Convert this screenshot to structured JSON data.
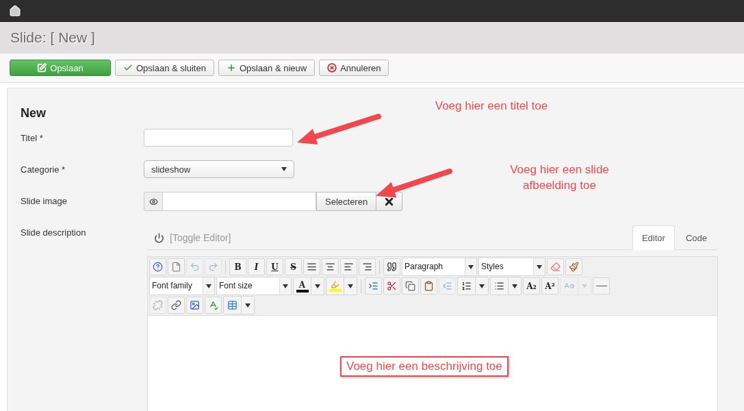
{
  "header": {
    "title": "Slide:",
    "subtitle": "[ New ]"
  },
  "toolbar": [
    {
      "kind": "save",
      "label": "Opslaan"
    },
    {
      "kind": "check",
      "label": "Opslaan & sluiten"
    },
    {
      "kind": "plus",
      "label": "Opslaan & nieuw"
    },
    {
      "kind": "cancel",
      "label": "Annuleren"
    }
  ],
  "form": {
    "heading": "New",
    "fields": [
      {
        "kind": "text",
        "label": "Titel *"
      },
      {
        "kind": "select",
        "label": "Categorie *",
        "value": "slideshow"
      },
      {
        "kind": "media",
        "label": "Slide image",
        "button": "Selecteren"
      },
      {
        "kind": "editor",
        "label": "Slide description"
      }
    ]
  },
  "editor": {
    "toggle": "[Toggle Editor]",
    "tabs": [
      {
        "label": "Editor",
        "selected": true
      },
      {
        "label": "Code",
        "selected": false
      }
    ],
    "toolbar": [
      [
        {
          "kind": "icon",
          "disabled": false
        },
        {
          "kind": "icon",
          "disabled": false
        },
        {
          "kind": "icon",
          "disabled": true
        },
        {
          "kind": "icon",
          "disabled": true
        },
        {
          "kind": "sep"
        },
        {
          "kind": "text",
          "label": "B",
          "disabled": false
        },
        {
          "kind": "text",
          "label": "I",
          "disabled": false
        },
        {
          "kind": "text",
          "label": "U",
          "disabled": false
        },
        {
          "kind": "text",
          "label": "S",
          "disabled": false
        },
        {
          "kind": "icon",
          "disabled": false
        },
        {
          "kind": "icon",
          "disabled": false
        },
        {
          "kind": "icon",
          "disabled": false
        },
        {
          "kind": "icon",
          "disabled": false
        },
        {
          "kind": "sep"
        },
        {
          "kind": "icon",
          "disabled": false
        },
        {
          "kind": "select",
          "label": "Paragraph"
        },
        {
          "kind": "select",
          "label": "Styles"
        },
        {
          "kind": "icon",
          "disabled": false
        },
        {
          "kind": "icon",
          "disabled": false
        }
      ],
      [
        {
          "kind": "select",
          "label": "Font family"
        },
        {
          "kind": "select",
          "label": "Font size"
        },
        {
          "kind": "color",
          "label": "A",
          "color": "#000000"
        },
        {
          "kind": "color-icon",
          "color": "#ffff00"
        },
        {
          "kind": "sep"
        },
        {
          "kind": "icon",
          "disabled": false
        },
        {
          "kind": "icon",
          "disabled": false
        },
        {
          "kind": "icon",
          "disabled": false
        },
        {
          "kind": "icon",
          "disabled": false
        },
        {
          "kind": "icon",
          "disabled": true
        },
        {
          "kind": "split",
          "disabled": false
        },
        {
          "kind": "split",
          "disabled": false
        },
        {
          "kind": "text",
          "label": "A₂",
          "disabled": false
        },
        {
          "kind": "text",
          "label": "A²",
          "disabled": false
        },
        {
          "kind": "split",
          "disabled": true
        },
        {
          "kind": "icon",
          "disabled": false
        }
      ],
      [
        {
          "kind": "icon",
          "disabled": true
        },
        {
          "kind": "icon",
          "disabled": false
        },
        {
          "kind": "icon",
          "disabled": false
        },
        {
          "kind": "icon",
          "disabled": false
        },
        {
          "kind": "split",
          "disabled": false
        }
      ]
    ]
  },
  "annotations": [
    {
      "kind": "arrow-note",
      "text": "Voeg hier een titel toe"
    },
    {
      "kind": "arrow-note",
      "text": "Voeg hier een slide afbeelding toe"
    },
    {
      "kind": "boxed",
      "text": "Voeg hier een beschrijving toe"
    }
  ]
}
